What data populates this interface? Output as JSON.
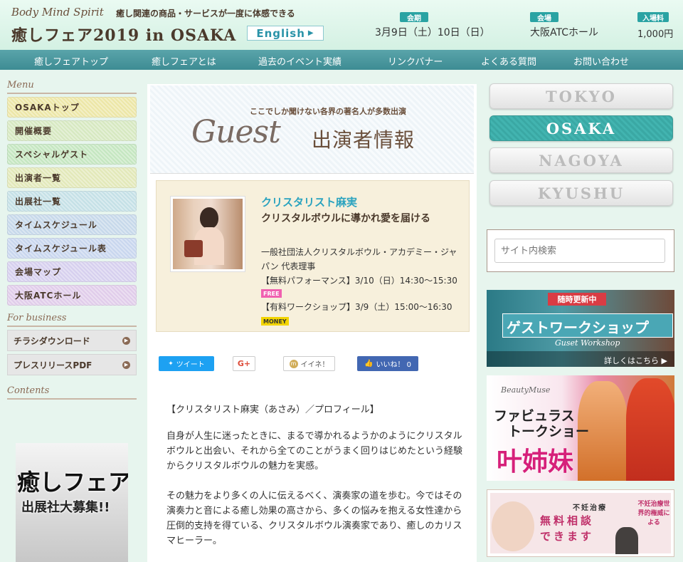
{
  "header": {
    "tagline": "Body Mind Spirit",
    "tagline_jp": "癒し関連の商品・サービスが一度に体感できる",
    "title": "癒しフェア2019 in OSAKA",
    "english_label": "English",
    "period_label": "会期",
    "period_value": "3月9日（土）10日（日）",
    "venue_label": "会場",
    "venue_value": "大阪ATCホール",
    "fee_label": "入場料",
    "fee_value": "1,000円"
  },
  "nav": [
    "癒しフェアトップ",
    "癒しフェアとは",
    "過去のイベント実績",
    "リンクバナー",
    "よくある質問",
    "お問い合わせ"
  ],
  "sidebar": {
    "menu_heading": "Menu",
    "menu": [
      {
        "label": "OSAKAトップ",
        "color": "#ece6a6"
      },
      {
        "label": "開催概要",
        "color": "#d6e8c0"
      },
      {
        "label": "スペシャルゲスト",
        "color": "#c4e6c0"
      },
      {
        "label": "出演者一覧",
        "color": "#e2e8b8"
      },
      {
        "label": "出展社一覧",
        "color": "#c4e0e6"
      },
      {
        "label": "タイムスケジュール",
        "color": "#c6d8ea"
      },
      {
        "label": "タイムスケジュール表",
        "color": "#c8d6ee"
      },
      {
        "label": "会場マップ",
        "color": "#d6cfee"
      },
      {
        "label": "大阪ATCホール",
        "color": "#e0ccea"
      }
    ],
    "business_heading": "For business",
    "business": [
      {
        "label": "チラシダウンロード"
      },
      {
        "label": "プレスリリースPDF"
      }
    ],
    "contents_heading": "Contents",
    "contents_banner_big": "癒しフェア",
    "contents_banner_sub": "出展社大募集!!"
  },
  "guest": {
    "subtitle": "ここでしか聞けない各界の著名人が多数出演",
    "script": "Guest",
    "heading": "出演者情報"
  },
  "performer": {
    "name": "クリスタリスト麻実",
    "title": "クリスタルボウルに導かれ愛を届ける",
    "org": "一般社団法人クリスタルボウル・アカデミー・ジャパン 代表理事",
    "performance": "【無料パフォーマンス】3/10（日）14:30～15:30",
    "free_tag": "FREE",
    "workshop": "【有料ワークショップ】3/9（土）15:00～16:30",
    "money_tag": "MONEY"
  },
  "share": {
    "tweet": "ツイート",
    "gplus": "G+",
    "mixi": "イイネ！",
    "fb": "いいね！ 0"
  },
  "profile": {
    "heading": "【クリスタリスト麻実（あさみ）／プロフィール】",
    "p1": "自身が人生に迷ったときに、まるで導かれるようかのようにクリスタルボウルと出会い、それから全てのことがうまく回りはじめたという経験からクリスタルボウルの魅力を実感。",
    "p2": "その魅力をより多くの人に伝えるべく、演奏家の道を歩む。今ではその演奏力と音による癒し効果の高さから、多くの悩みを抱える女性達から圧倒的支持を得ている、クリスタルボウル演奏家であり、癒しのカリスマヒーラー。"
  },
  "right": {
    "cities": [
      "TOKYO",
      "OSAKA",
      "NAGOYA",
      "KYUSHU"
    ],
    "active_city": "OSAKA",
    "search_placeholder": "サイト内検索",
    "ad1_badge": "随時更新中",
    "ad1_title": "ゲストワークショップ",
    "ad1_sub": "Guset Workshop",
    "ad1_more": "詳しくはこちら ▶",
    "ad2_script": "BeautyMuse",
    "ad2_line1": "ファビュラス",
    "ad2_line2": "トークショー",
    "ad2_name": "叶姉妹",
    "ad3_top": "不妊治療",
    "ad3_line1": "無料相談",
    "ad3_line2": "できます",
    "ad3_side": "不妊治療世界的権威による"
  },
  "colors": {
    "accent": "#2aa3a3",
    "nav_bg": "#4a979e",
    "page_bg": "#e7f5ee"
  }
}
